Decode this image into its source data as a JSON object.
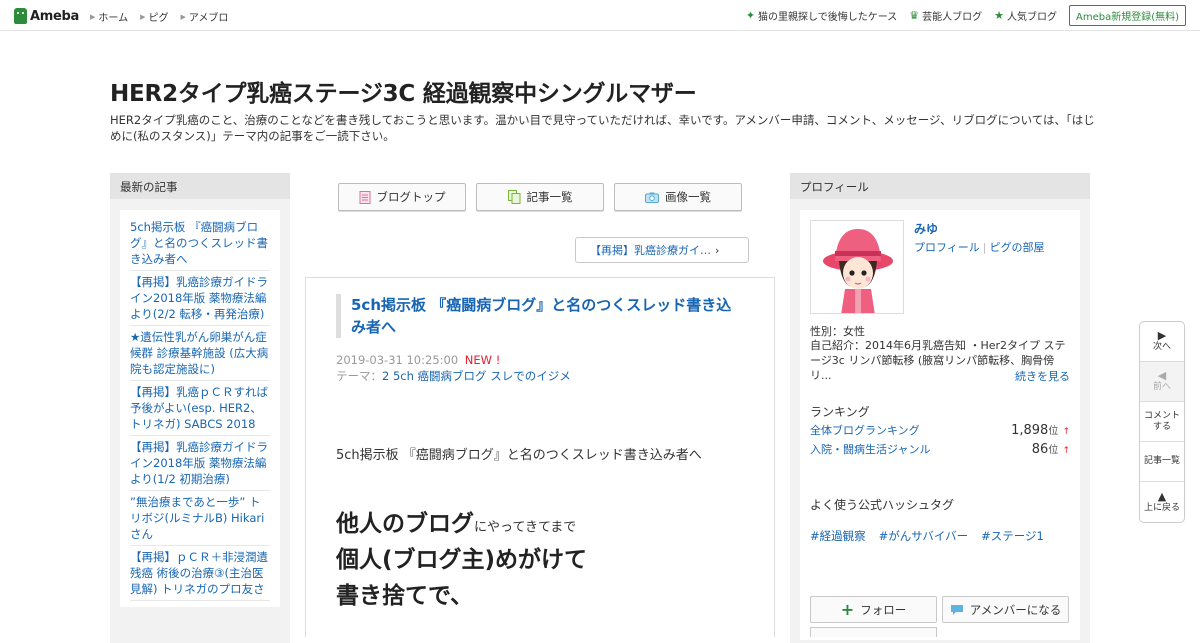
{
  "header": {
    "logo_text": "Ameba",
    "nav": [
      "ホーム",
      "ピグ",
      "アメブロ"
    ],
    "links": [
      {
        "icon": "sparkle-icon",
        "label": "猫の里親探しで後悔したケース"
      },
      {
        "icon": "crown-icon",
        "label": "芸能人ブログ"
      },
      {
        "icon": "star-icon",
        "label": "人気ブログ"
      }
    ],
    "register_label": "Ameba新規登録(無料)"
  },
  "blog": {
    "title": "HER2タイプ乳癌ステージ3C 経過観察中シングルマザー",
    "description": "HER2タイプ乳癌のこと、治療のことなどを書き残しておこうと思います。温かい目で見守っていただければ、幸いです。アメンバー申請、コメント、メッセージ、リブログについては、「はじめに(私のスタンス)」テーマ内の記事をご一読下さい。"
  },
  "recent": {
    "heading": "最新の記事",
    "entries": [
      "5ch掲示板 『癌闘病ブログ』と名のつくスレッド書き込み者へ",
      "【再掲】乳癌診療ガイドライン2018年版 薬物療法編より(2/2 転移・再発治療)",
      "★遺伝性乳がん卵巣がん症候群 診療基幹施設 (広大病院も認定施設に)",
      "【再掲】乳癌ｐＣＲすれば予後がよい(esp. HER2、トリネガ) SABCS 2018",
      "【再掲】乳癌診療ガイドライン2018年版 薬物療法編より(1/2 初期治療)",
      "”無治療まであと一歩” トリボジ(ルミナルB) Hikariさん",
      "【再掲】ｐＣＲ＋非浸潤遺残癌 術後の治療③(主治医見解) トリネガのプロ友さ"
    ]
  },
  "tabs": {
    "blog_top": "ブログトップ",
    "entry_list": "記事一覧",
    "image_list": "画像一覧"
  },
  "pager": {
    "prev_label": "【再掲】乳癌診療ガイ…"
  },
  "article": {
    "title": "5ch掲示板 『癌闘病ブログ』と名のつくスレッド書き込み者へ",
    "datetime": "2019-03-31 10:25:00",
    "new_badge": "NEW !",
    "theme_label": "テーマ：",
    "theme": "2 5ch 癌闘病ブログ スレでのイジメ",
    "body_line": "5ch掲示板 『癌闘病ブログ』と名のつくスレッド書き込み者へ",
    "big1": "他人のブログ",
    "big1_small": "にやってきてまで",
    "big2": "個人(ブログ主)めがけて",
    "big3": "書き捨てで、"
  },
  "profile": {
    "heading": "プロフィール",
    "name": "みゆ",
    "profile_link": "プロフィール",
    "pig_link": "ピグの部屋",
    "gender": "性別：女性",
    "intro": "自己紹介：2014年6月乳癌告知 ・Her2タイプ ステージ3c リンパ節転移 (腋窩リンパ節転移、胸骨傍リ...",
    "read_more": "続きを見る",
    "ranking_heading": "ランキング",
    "rankings": [
      {
        "label": "全体ブログランキング",
        "value": "1,898",
        "unit": "位",
        "trend": "↑"
      },
      {
        "label": "入院・闘病生活ジャンル",
        "value": "86",
        "unit": "位",
        "trend": "↑"
      }
    ],
    "hashtag_heading": "よく使う公式ハッシュタグ",
    "hashtags": [
      "#経過観察",
      "#がんサバイバー",
      "#ステージ1"
    ],
    "follow_label": "フォロー",
    "amember_label": "アメンバーになる"
  },
  "floating": {
    "next": "次へ",
    "prev": "前へ",
    "comment": "コメントする",
    "list": "記事一覧",
    "top": "上に戻る"
  },
  "colors": {
    "brand_green": "#2d8c3c",
    "link_blue": "#1866b3",
    "new_red": "#e3222e"
  }
}
